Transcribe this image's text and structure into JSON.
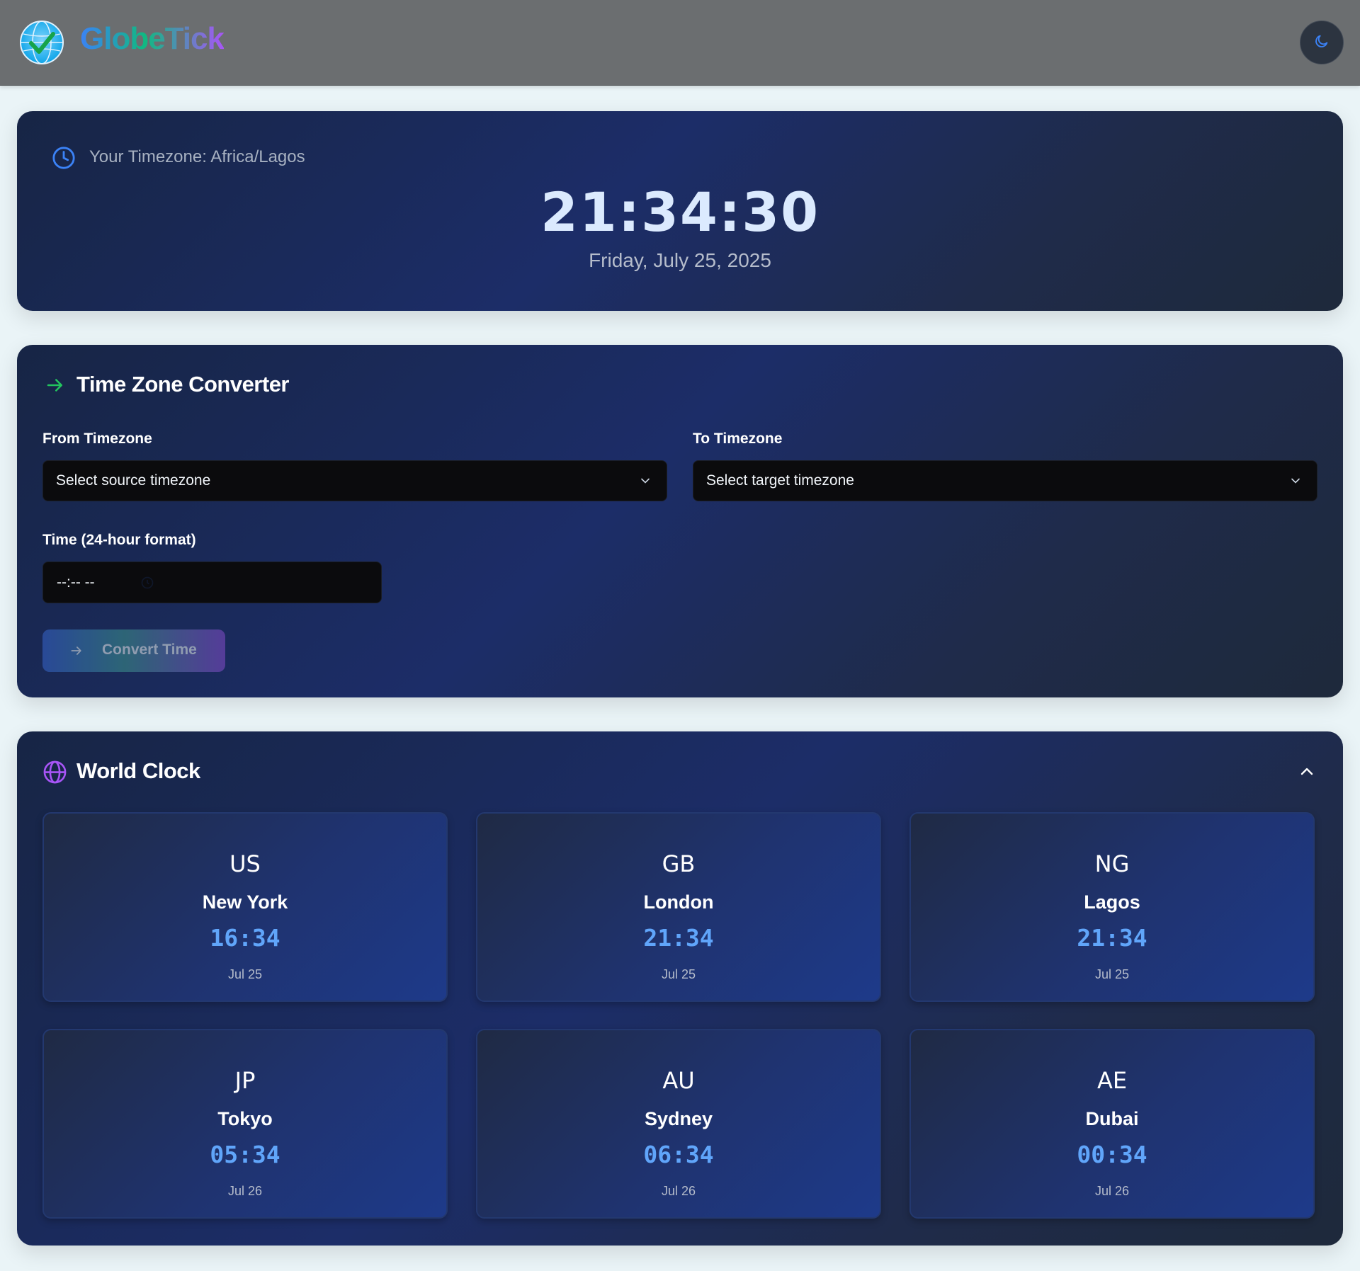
{
  "app": {
    "name": "GlobeTick"
  },
  "current": {
    "timezone_label": "Your Timezone: Africa/Lagos",
    "time": "21:34:30",
    "date": "Friday, July 25, 2025"
  },
  "converter": {
    "title": "Time Zone Converter",
    "from_label": "From Timezone",
    "from_placeholder": "Select source timezone",
    "to_label": "To Timezone",
    "to_placeholder": "Select target timezone",
    "time_label": "Time (24-hour format)",
    "time_value": "--:-- --",
    "button_label": "Convert Time"
  },
  "world_clock": {
    "title": "World Clock",
    "clocks": [
      {
        "code": "US",
        "city": "New York",
        "time": "16:34",
        "date": "Jul 25"
      },
      {
        "code": "GB",
        "city": "London",
        "time": "21:34",
        "date": "Jul 25"
      },
      {
        "code": "NG",
        "city": "Lagos",
        "time": "21:34",
        "date": "Jul 25"
      },
      {
        "code": "JP",
        "city": "Tokyo",
        "time": "05:34",
        "date": "Jul 26"
      },
      {
        "code": "AU",
        "city": "Sydney",
        "time": "06:34",
        "date": "Jul 26"
      },
      {
        "code": "AE",
        "city": "Dubai",
        "time": "00:34",
        "date": "Jul 26"
      }
    ]
  },
  "icons": {
    "logo": "globe-check-icon",
    "theme": "moon-icon",
    "clock": "clock-icon",
    "converter": "arrow-right-icon",
    "world": "globe-icon",
    "collapse": "chevron-up-icon",
    "select": "chevron-down-icon"
  },
  "colors": {
    "accent_blue": "#3b82f6",
    "accent_green": "#22c55e",
    "accent_purple": "#a855f7",
    "time_blue": "#60a5fa"
  }
}
